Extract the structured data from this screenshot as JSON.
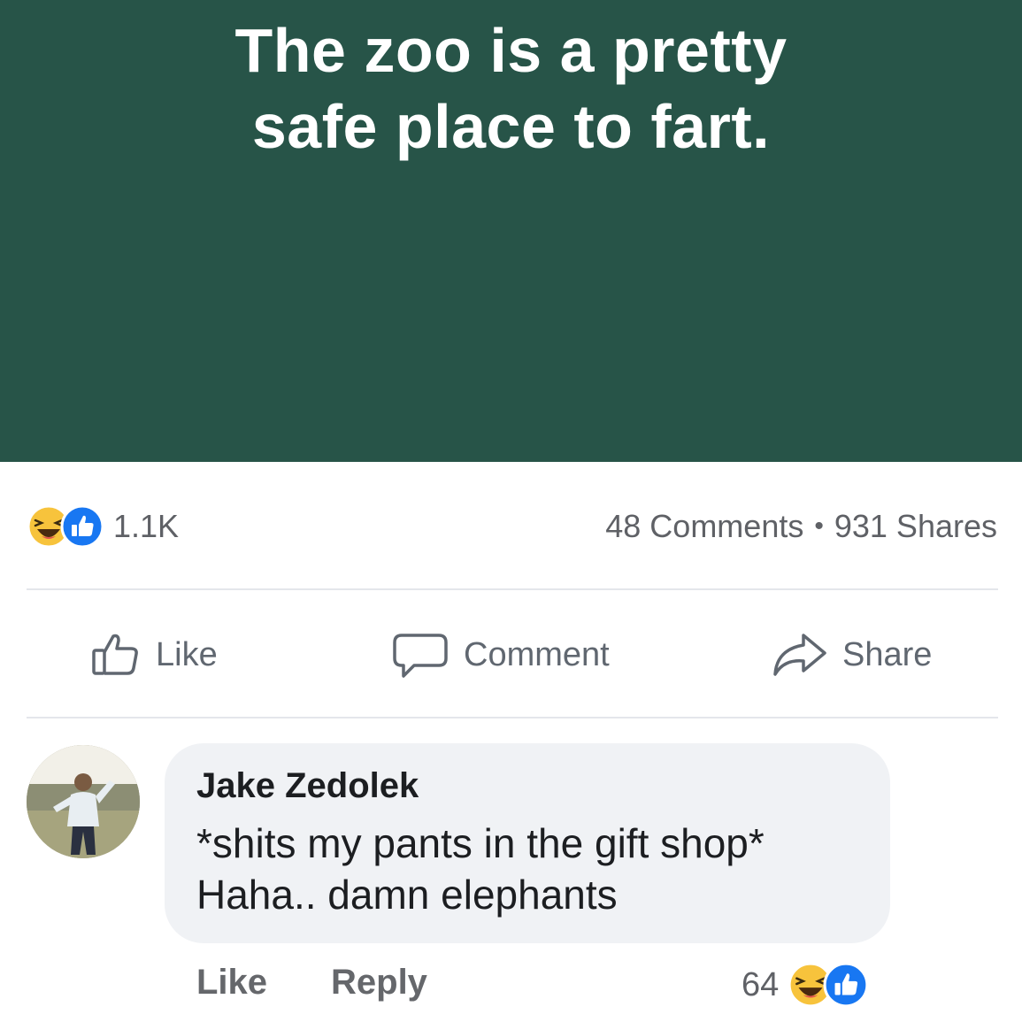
{
  "post": {
    "text_line1": "The zoo is a pretty",
    "text_line2": "safe place to fart.",
    "background_color": "#275448"
  },
  "summary": {
    "reaction_icons": [
      "haha-icon",
      "like-reaction-icon"
    ],
    "reaction_count": "1.1K",
    "comments": "48 Comments",
    "separator": "•",
    "shares": "931 Shares"
  },
  "actions": {
    "like_label": "Like",
    "comment_label": "Comment",
    "share_label": "Share"
  },
  "comment": {
    "author": "Jake Zedolek",
    "line1": "*shits my pants in the gift shop*",
    "line2": "Haha.. damn elephants",
    "like_label": "Like",
    "reply_label": "Reply",
    "reaction_count": "64",
    "reaction_icons": [
      "haha-icon",
      "like-reaction-icon"
    ]
  },
  "colors": {
    "like_blue": "#1877f2",
    "haha_yellow": "#f7c33c",
    "muted_text": "#65676b"
  }
}
